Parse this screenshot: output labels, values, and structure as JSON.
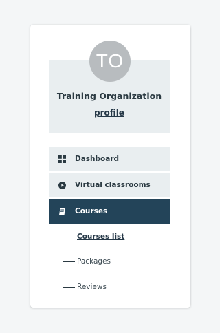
{
  "profile": {
    "initials": "TO",
    "name": "Training Organization",
    "link_label": "profile"
  },
  "nav": {
    "items": [
      {
        "label": "Dashboard",
        "icon": "grid-icon",
        "active": false
      },
      {
        "label": "Virtual classrooms",
        "icon": "play-circle-icon",
        "active": false
      },
      {
        "label": "Courses",
        "icon": "book-icon",
        "active": true
      }
    ]
  },
  "subnav": {
    "items": [
      {
        "label": "Courses list",
        "active": true
      },
      {
        "label": "Packages",
        "active": false
      },
      {
        "label": "Reviews",
        "active": false
      }
    ]
  },
  "colors": {
    "active_bg": "#234459",
    "item_bg": "#e9eef0",
    "avatar_bg": "#b8bcbf"
  }
}
